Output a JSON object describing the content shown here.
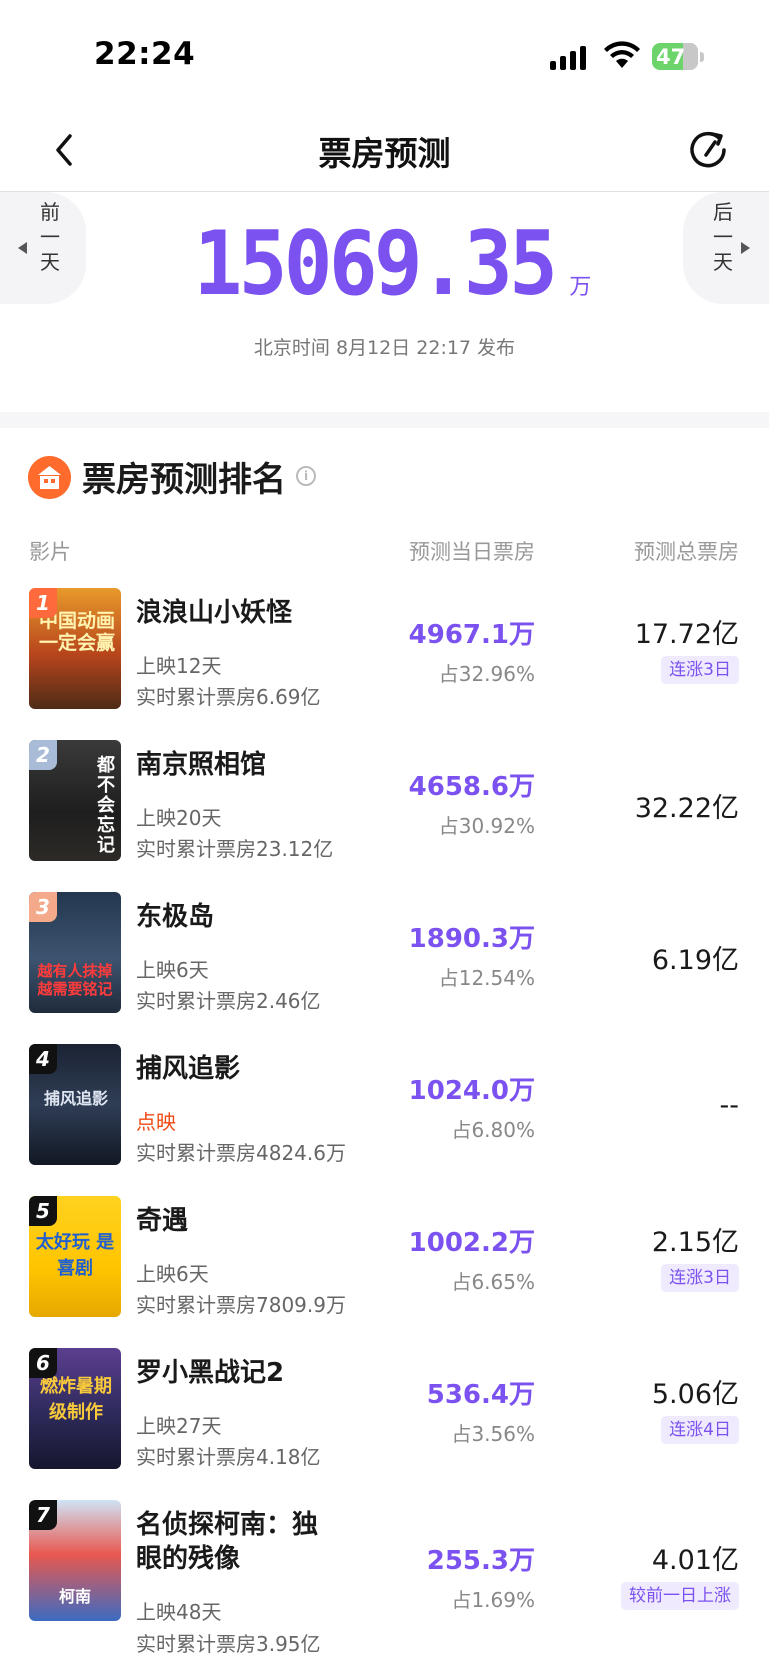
{
  "status_bar": {
    "time": "22:24",
    "battery": "47"
  },
  "nav": {
    "title": "票房预测"
  },
  "forecast": {
    "prev_label": [
      "前",
      "一",
      "天"
    ],
    "next_label": [
      "后",
      "一",
      "天"
    ],
    "total_value": "15069.35",
    "total_unit": "万",
    "publish_text": "北京时间 8月12日 22:17 发布"
  },
  "ranking": {
    "title": "票房预测排名",
    "columns": {
      "film": "影片",
      "daily": "预测当日票房",
      "total": "预测总票房"
    },
    "rows": [
      {
        "rank": "1",
        "name": "浪浪山小妖怪",
        "days": "上映12天",
        "cumulative": "实时累计票房6.69亿",
        "daily": "4967.1万",
        "share": "占32.96%",
        "total": "17.72亿",
        "tag": "连涨3日",
        "poster_text": "中国动画一定会赢"
      },
      {
        "rank": "2",
        "name": "南京照相馆",
        "days": "上映20天",
        "cumulative": "实时累计票房23.12亿",
        "daily": "4658.6万",
        "share": "占30.92%",
        "total": "32.22亿",
        "tag": "",
        "poster_text": "都不会忘记"
      },
      {
        "rank": "3",
        "name": "东极岛",
        "days": "上映6天",
        "cumulative": "实时累计票房2.46亿",
        "daily": "1890.3万",
        "share": "占12.54%",
        "total": "6.19亿",
        "tag": "",
        "poster_text": "越有人抹掉越需要铭记"
      },
      {
        "rank": "4",
        "name": "捕风追影",
        "days": "点映",
        "cumulative": "实时累计票房4824.6万",
        "daily": "1024.0万",
        "share": "占6.80%",
        "total": "--",
        "tag": "",
        "poster_text": "捕风追影"
      },
      {
        "rank": "5",
        "name": "奇遇",
        "days": "上映6天",
        "cumulative": "实时累计票房7809.9万",
        "daily": "1002.2万",
        "share": "占6.65%",
        "total": "2.15亿",
        "tag": "连涨3日",
        "poster_text": "太好玩 是喜剧"
      },
      {
        "rank": "6",
        "name": "罗小黑战记2",
        "days": "上映27天",
        "cumulative": "实时累计票房4.18亿",
        "daily": "536.4万",
        "share": "占3.56%",
        "total": "5.06亿",
        "tag": "连涨4日",
        "poster_text": "燃炸暑期 级制作"
      },
      {
        "rank": "7",
        "name": "名侦探柯南：独眼的残像",
        "days": "上映48天",
        "cumulative": "实时累计票房3.95亿",
        "daily": "255.3万",
        "share": "占1.69%",
        "total": "4.01亿",
        "tag": "较前一日上涨",
        "poster_text": "柯南"
      }
    ]
  }
}
